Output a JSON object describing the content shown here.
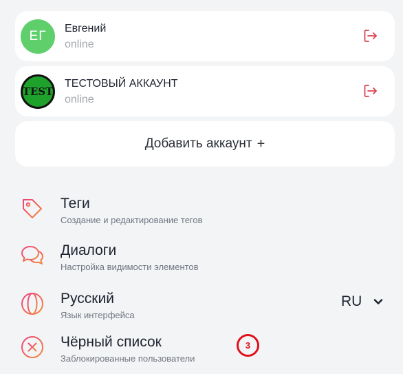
{
  "accounts": [
    {
      "initials": "ЕГ",
      "name": "Евгений",
      "status": "online"
    },
    {
      "avatar_text": "TEST",
      "name": "ТЕСТОВЫЙ АККАУНТ",
      "status": "online"
    }
  ],
  "add_account": {
    "label": "Добавить аккаунт",
    "plus": "+"
  },
  "menu": {
    "tags": {
      "title": "Теги",
      "subtitle": "Создание и редактирование тегов"
    },
    "dialogs": {
      "title": "Диалоги",
      "subtitle": "Настройка видимости элементов"
    },
    "language": {
      "title": "Русский",
      "subtitle": "Язык интерфейса",
      "value": "RU"
    },
    "blacklist": {
      "title": "Чёрный список",
      "subtitle": "Заблокированные пользователи",
      "badge": "3"
    }
  },
  "colors": {
    "background": "#f3f4f6",
    "card": "#ffffff",
    "avatar_green": "#5fcf6b",
    "test_avatar_green": "#1fa22b",
    "logout_red": "#d9434f",
    "icon_gradient_start": "#f0417a",
    "icon_gradient_end": "#f28a3c",
    "badge_red": "#e0111b"
  },
  "icons": {
    "logout": "logout-icon",
    "tags": "tag-icon",
    "dialogs": "chat-bubbles-icon",
    "language": "globe-icon",
    "blacklist": "x-circle-icon",
    "dropdown": "chevron-down-icon"
  }
}
